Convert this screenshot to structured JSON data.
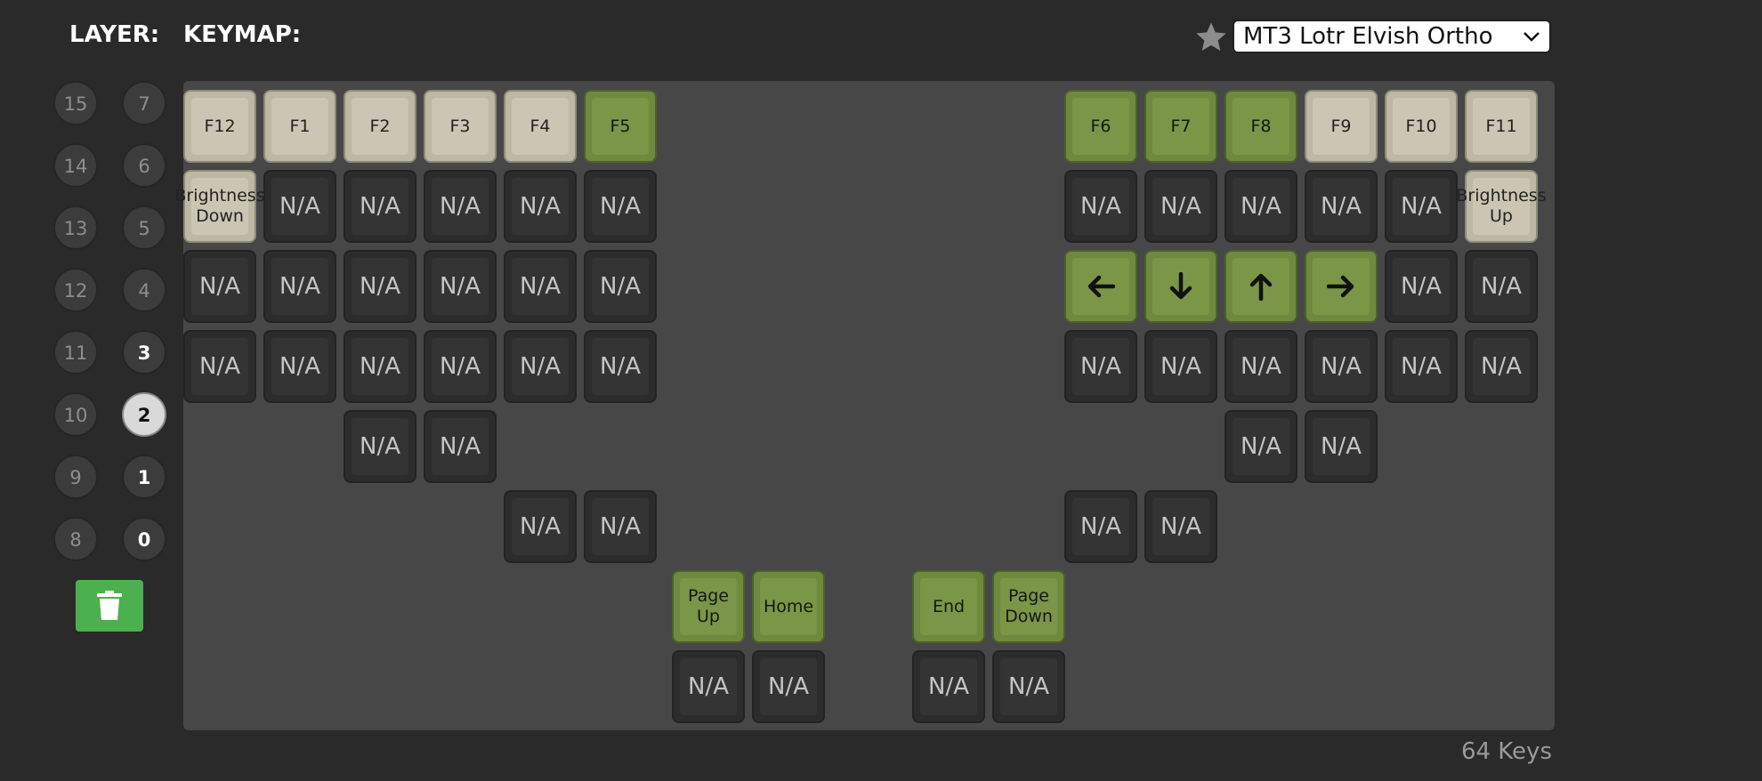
{
  "header": {
    "layer_label": "LAYER:",
    "keymap_label": "KEYMAP:",
    "keymap_select": {
      "value": "MT3 Lotr Elvish Ortho"
    }
  },
  "layers": {
    "left_column": [
      "15",
      "14",
      "13",
      "12",
      "11",
      "10",
      "9",
      "8"
    ],
    "right_column": [
      "7",
      "6",
      "5",
      "4",
      "3",
      "2",
      "1",
      "0"
    ],
    "active": "2",
    "used": [
      "3",
      "1",
      "0"
    ]
  },
  "keys": {
    "row1": [
      "F12",
      "F1",
      "F2",
      "F3",
      "F4",
      "F5",
      "F6",
      "F7",
      "F8",
      "F9",
      "F10",
      "F11"
    ],
    "row2": [
      "Brightness Down",
      "N/A",
      "N/A",
      "N/A",
      "N/A",
      "N/A",
      "N/A",
      "N/A",
      "N/A",
      "N/A",
      "N/A",
      "Brightness Up"
    ],
    "row3": [
      "N/A",
      "N/A",
      "N/A",
      "N/A",
      "N/A",
      "N/A",
      "left-arrow-icon",
      "down-arrow-icon",
      "up-arrow-icon",
      "right-arrow-icon",
      "N/A",
      "N/A"
    ],
    "row4": [
      "N/A",
      "N/A",
      "N/A",
      "N/A",
      "N/A",
      "N/A",
      "N/A",
      "N/A",
      "N/A",
      "N/A",
      "N/A",
      "N/A"
    ],
    "row5": [
      "N/A",
      "N/A",
      "N/A",
      "N/A"
    ],
    "row6": [
      "N/A",
      "N/A",
      "N/A",
      "N/A"
    ],
    "thumb_top": [
      "Page Up",
      "Home",
      "End",
      "Page Down"
    ],
    "thumb_bottom": [
      "N/A",
      "N/A",
      "N/A",
      "N/A"
    ]
  },
  "footer": {
    "key_count": "64 Keys"
  },
  "colors": {
    "green_key": "#7b9646",
    "beige_key": "#cbc6b3",
    "na_key": "#343434",
    "trash": "#4cb04f"
  }
}
